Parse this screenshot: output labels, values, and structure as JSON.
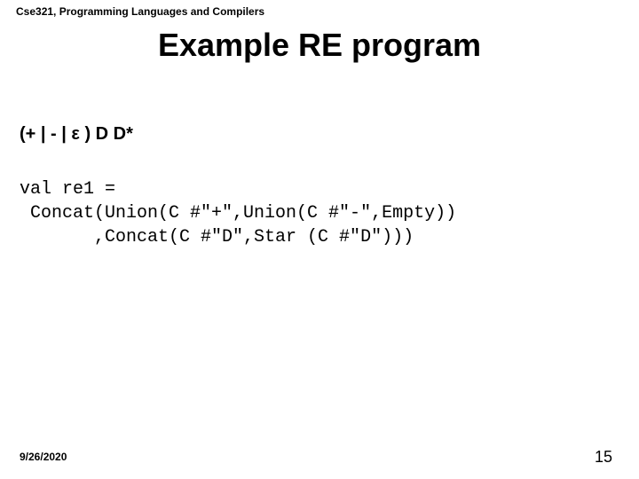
{
  "header": {
    "course": "Cse321, Programming Languages and Compilers"
  },
  "title": "Example RE program",
  "regex": "(+ | - | ε ) D D*",
  "code": {
    "line1": "val re1 =",
    "line2": " Concat(Union(C #\"+\",Union(C #\"-\",Empty))",
    "line3": "       ,Concat(C #\"D\",Star (C #\"D\")))"
  },
  "footer": {
    "date": "9/26/2020",
    "page": "15"
  }
}
